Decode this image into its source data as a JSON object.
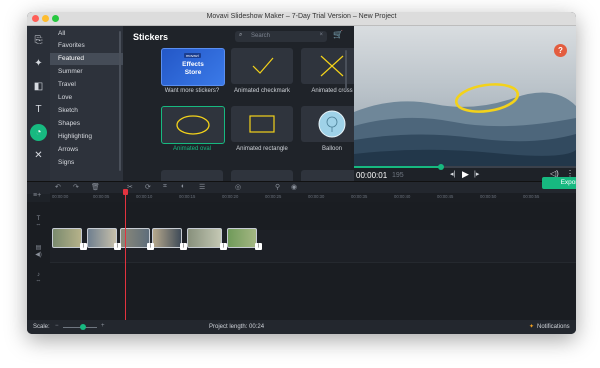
{
  "window": {
    "title": "Movavi Slideshow Maker – 7-Day Trial Version – New Project"
  },
  "categories": [
    "All",
    "Favorites",
    "Featured",
    "Summer",
    "Travel",
    "Love",
    "Sketch",
    "Shapes",
    "Highlighting",
    "Arrows",
    "Signs"
  ],
  "selected_category": "Featured",
  "stickers": {
    "title": "Stickers",
    "search_placeholder": "Search",
    "items": [
      {
        "label": "Want more stickers?",
        "badge": "movavi",
        "line1": "Effects",
        "line2": "Store"
      },
      {
        "label": "Animated checkmark"
      },
      {
        "label": "Animated cross"
      },
      {
        "label": "Animated oval"
      },
      {
        "label": "Animated rectangle"
      },
      {
        "label": "Balloon"
      }
    ]
  },
  "player": {
    "time_main": "00:00:01",
    "time_frame": "195"
  },
  "timeline": {
    "export_label": "Export",
    "ticks": [
      "00:00:00",
      "00:00:05",
      "00:00:10",
      "00:00:15",
      "00:00:20",
      "00:00:25",
      "00:00:30",
      "00:00:35",
      "00:00:40",
      "00:00:45",
      "00:00:50",
      "00:00:55"
    ]
  },
  "status": {
    "scale_label": "Scale:",
    "project_length": "Project length:  00:24",
    "notifications": "Notifications"
  },
  "colors": {
    "accent": "#17b980",
    "sticker_yellow": "#f3d21a",
    "help": "#e35d3f",
    "playhead": "#e2333f"
  }
}
